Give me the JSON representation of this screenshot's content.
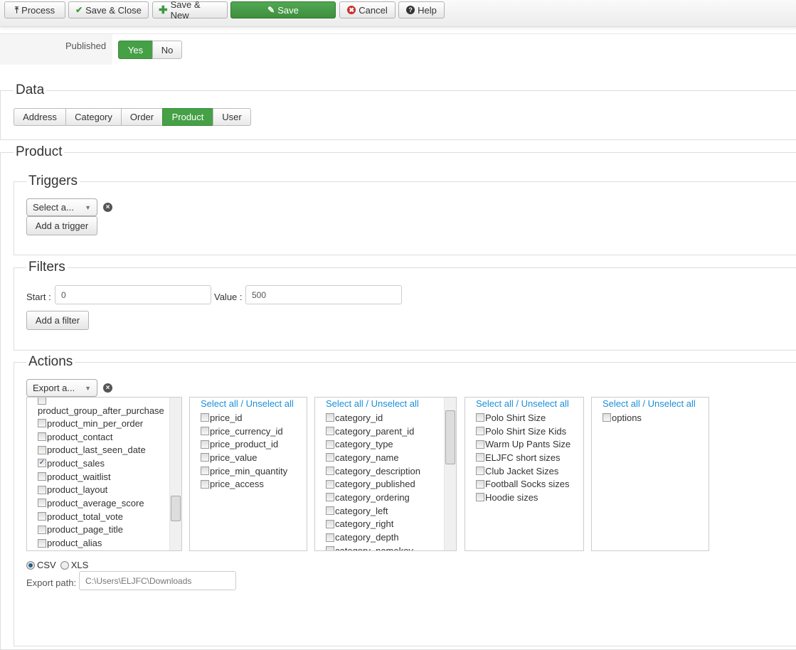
{
  "toolbar": {
    "process": "Process",
    "save_close": "Save & Close",
    "save_new": "Save & New",
    "save": "Save",
    "cancel": "Cancel",
    "help": "Help"
  },
  "published": {
    "label": "Published",
    "yes": "Yes",
    "no": "No",
    "value": "Yes"
  },
  "data_section": {
    "legend": "Data",
    "tabs": [
      "Address",
      "Category",
      "Order",
      "Product",
      "User"
    ],
    "active": "Product"
  },
  "product": {
    "legend": "Product"
  },
  "triggers": {
    "legend": "Triggers",
    "select": "Select a...",
    "add": "Add a trigger"
  },
  "filters": {
    "legend": "Filters",
    "start_label": "Start :",
    "start_value": "0",
    "value_label": "Value :",
    "value_value": "500",
    "add": "Add a filter"
  },
  "actions": {
    "legend": "Actions",
    "select": "Export a...",
    "select_all": "Select all",
    "sep": " / ",
    "unselect_all": "Unselect all",
    "product_columns": [
      {
        "label": "product_group_after_purchase",
        "checked": false
      },
      {
        "label": "product_min_per_order",
        "checked": false
      },
      {
        "label": "product_contact",
        "checked": false
      },
      {
        "label": "product_last_seen_date",
        "checked": false
      },
      {
        "label": "product_sales",
        "checked": true
      },
      {
        "label": "product_waitlist",
        "checked": false
      },
      {
        "label": "product_layout",
        "checked": false
      },
      {
        "label": "product_average_score",
        "checked": false
      },
      {
        "label": "product_total_vote",
        "checked": false
      },
      {
        "label": "product_page_title",
        "checked": false
      },
      {
        "label": "product_alias",
        "checked": false
      }
    ],
    "price_columns": [
      "price_id",
      "price_currency_id",
      "price_product_id",
      "price_value",
      "price_min_quantity",
      "price_access"
    ],
    "category_columns": [
      "category_id",
      "category_parent_id",
      "category_type",
      "category_name",
      "category_description",
      "category_published",
      "category_ordering",
      "category_left",
      "category_right",
      "category_depth",
      "category_namekey"
    ],
    "characteristic_columns": [
      "Polo Shirt Size",
      "Polo Shirt Size Kids",
      "Warm Up Pants Size",
      "ELJFC short sizes",
      "Club Jacket Sizes",
      "Football Socks sizes",
      "Hoodie sizes"
    ],
    "other_columns": [
      "options"
    ],
    "format": {
      "csv": "CSV",
      "xls": "XLS",
      "selected": "CSV"
    },
    "export_path_label": "Export path:",
    "export_path": "C:\\Users\\ELJFC\\Downloads"
  }
}
